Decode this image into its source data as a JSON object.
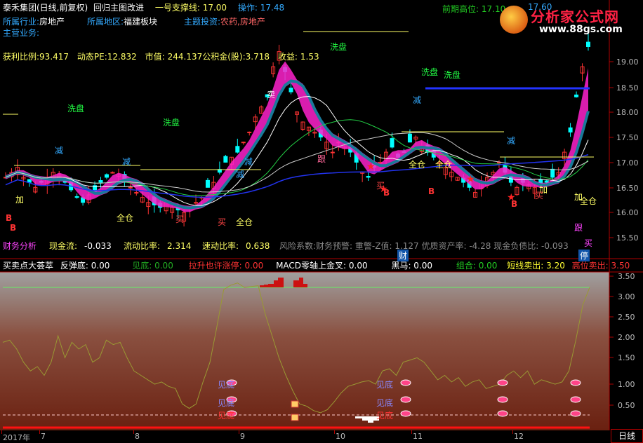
{
  "header": {
    "row1": [
      {
        "text": "泰禾集团(日线,前复权)",
        "color": "#ffffff"
      },
      {
        "text": "回归主图改进",
        "color": "#ffffff"
      },
      {
        "text": "一号支撑线: 17.00",
        "color": "#ffff66"
      },
      {
        "text": "操作: 17.48",
        "color": "#33aaff"
      }
    ],
    "right_label": "前期高位: 17.10",
    "right_value": "17.60"
  },
  "info": {
    "industry_label": "所属行业:",
    "industry_value": "房地产",
    "region_label": "所属地区:",
    "region_value": "福建板块",
    "theme_label": "主题投资:",
    "theme_value": "农药,房地产",
    "business_label": "主营业务:",
    "metrics": [
      {
        "label": "获利比例:",
        "value": "93.417"
      },
      {
        "label": "动态PE:",
        "value": "12.832"
      },
      {
        "label": "市值:",
        "value": "244.137"
      },
      {
        "label": "公积金(股):",
        "value": "3.718"
      },
      {
        "label": "收益:",
        "value": "1.53"
      }
    ]
  },
  "fin_row": {
    "finance_analysis": "财务分析",
    "labels": [
      {
        "label": "现金流:",
        "value": "-0.033"
      },
      {
        "label": "流动比率:",
        "value": "2.314"
      },
      {
        "label": "速动比率:",
        "value": "0.638"
      }
    ],
    "risk": "风险系数:财务预警: 重警-Z值: 1.127 优质资产率: -4.28 现金负债比: -0.093"
  },
  "main_tags": {
    "xipan": "洗盘",
    "jian": "减",
    "mai_sell": "卖",
    "mai_buy": "买",
    "jia": "加",
    "quancang": "全仓",
    "gen": "跟",
    "B": "B",
    "cai": "财",
    "ting": "停"
  },
  "brand": {
    "logo_text": "分析家公式网",
    "url": "www.88gs.com"
  },
  "yaxis_main": [
    "19.00",
    "18.50",
    "18.00",
    "17.50",
    "17.00",
    "16.50",
    "16.00",
    "15.50"
  ],
  "yaxis_sub": [
    "3.50",
    "3.00",
    "2.50",
    "2.00",
    "1.50",
    "1.00",
    "0.50"
  ],
  "sub_header": [
    {
      "text": "买卖点大荟萃",
      "color": "#ffffff"
    },
    {
      "text": "反弹底: 0.00",
      "color": "#ffffff"
    },
    {
      "text": "见底: 0.00",
      "color": "#22aa22"
    },
    {
      "text": "拉升也许涨停: 0.00",
      "color": "#ff3333"
    },
    {
      "text": "MACD零轴上金叉: 0.00",
      "color": "#ffffff"
    },
    {
      "text": "黑马: 0.00",
      "color": "#ffffff"
    },
    {
      "text": "组合: 0.00",
      "color": "#22cc22"
    },
    {
      "text": "短线卖出: 3.20",
      "color": "#ffff33"
    },
    {
      "text": "高位卖出: 3.50",
      "color": "#ff3333"
    }
  ],
  "sub_tags": {
    "jiandi": "见底",
    "fandi": "见底",
    "mai": "买"
  },
  "xaxis": [
    {
      "text": "2017年"
    },
    {
      "text": "7"
    },
    {
      "text": "8"
    },
    {
      "text": "9"
    },
    {
      "text": "10"
    },
    {
      "text": "11"
    },
    {
      "text": "12"
    }
  ],
  "period_button": "日线",
  "colors": {
    "up": "#ff3333",
    "down": "#00ffff",
    "ma_blue": "#2233ee",
    "magenta": "#ff22cc",
    "teal": "#1a7a9a",
    "yellow": "#ffff66",
    "grid": "#b00000"
  }
}
